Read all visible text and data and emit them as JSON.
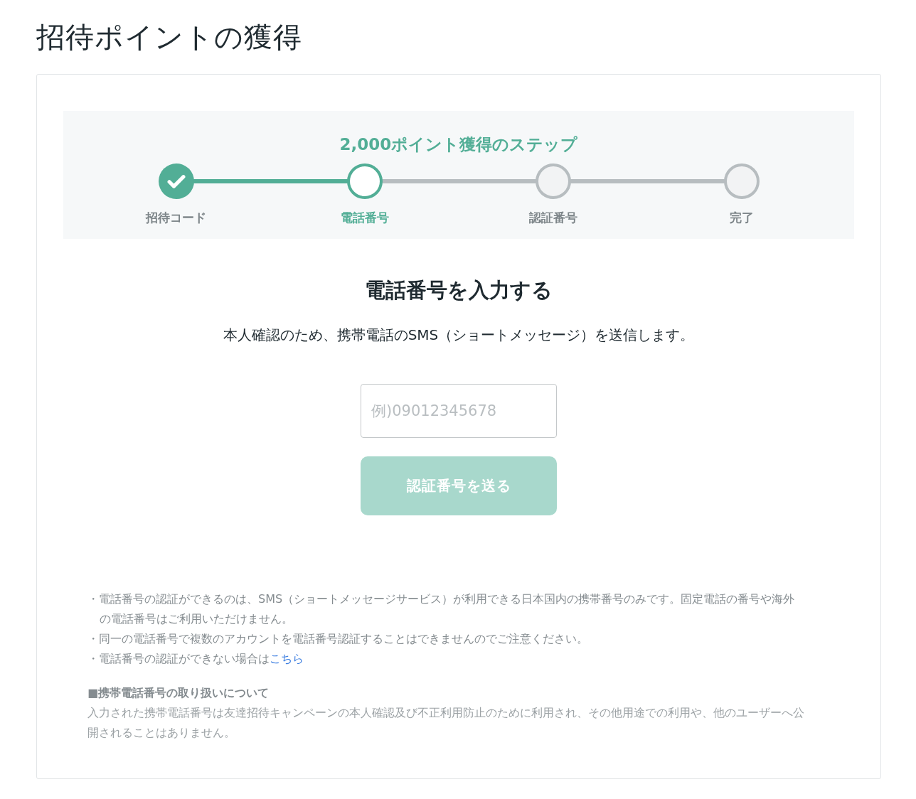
{
  "page_title": "招待ポイントの獲得",
  "steps_panel": {
    "title": "2,000ポイント獲得のステップ",
    "steps": [
      {
        "label": "招待コード",
        "done": true,
        "current": false
      },
      {
        "label": "電話番号",
        "done": false,
        "current": true
      },
      {
        "label": "認証番号",
        "done": false,
        "current": false
      },
      {
        "label": "完了",
        "done": false,
        "current": false
      }
    ]
  },
  "form": {
    "heading": "電話番号を入力する",
    "description": "本人確認のため、携帯電話のSMS（ショートメッセージ）を送信します。",
    "phone_field": {
      "placeholder": "例)09012345678"
    },
    "submit_button": {
      "label": "認証番号を送る",
      "disabled": true
    }
  },
  "notes": [
    {
      "text": "・電話番号の認証ができるのは、SMS（ショートメッセージサービス）が利用できる日本国内の携帯番号のみです。固定電話の番号や海外の電話番号はご利用いただけません。"
    },
    {
      "text": "・同一の電話番号で複数のアカウントを電話番号認証することはできませんのでご注意ください。"
    },
    {
      "text": "・電話番号の認証ができない場合は",
      "link": "こちら"
    }
  ],
  "privacy": {
    "heading": "■携帯電話番号の取り扱いについて",
    "body": "入力された携帯電話番号は友達招待キャンペーンの本人確認及び不正利用防止のために利用され、その他用途での利用や、他のユーザーへ公開されることはありません。"
  }
}
